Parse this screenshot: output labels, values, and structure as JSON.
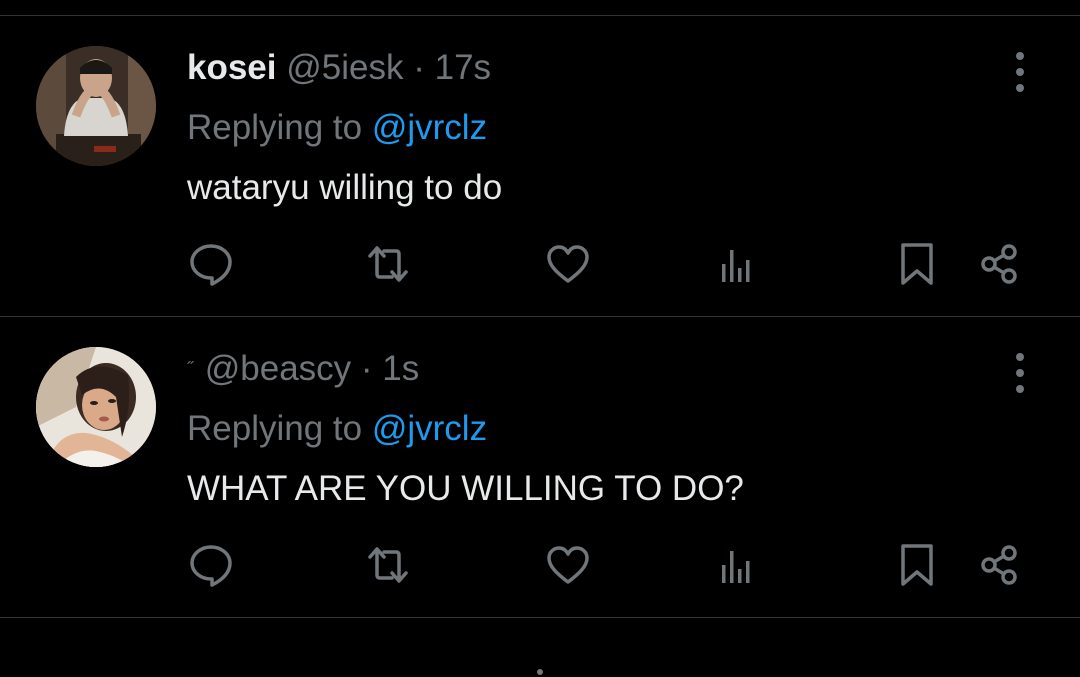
{
  "tweets": [
    {
      "display_name": "kosei",
      "handle": "@5iesk",
      "separator": "·",
      "time": "17s",
      "replying_prefix": "Replying to",
      "replying_to": "@jvrclz",
      "text": "wataryu willing to do"
    },
    {
      "display_name": "",
      "name_mark": "˝",
      "handle": "@beascy",
      "separator": "·",
      "time": "1s",
      "replying_prefix": "Replying to",
      "replying_to": "@jvrclz",
      "text": "WHAT ARE YOU WILLING TO DO?"
    }
  ],
  "actions": [
    "reply-icon",
    "retweet-icon",
    "like-icon",
    "views-icon",
    "bookmark-icon",
    "share-icon"
  ],
  "colors": {
    "background": "#000000",
    "primary_text": "#e7e9ea",
    "secondary_text": "#71767b",
    "accent": "#1d9bf0",
    "divider": "#2f3336"
  }
}
